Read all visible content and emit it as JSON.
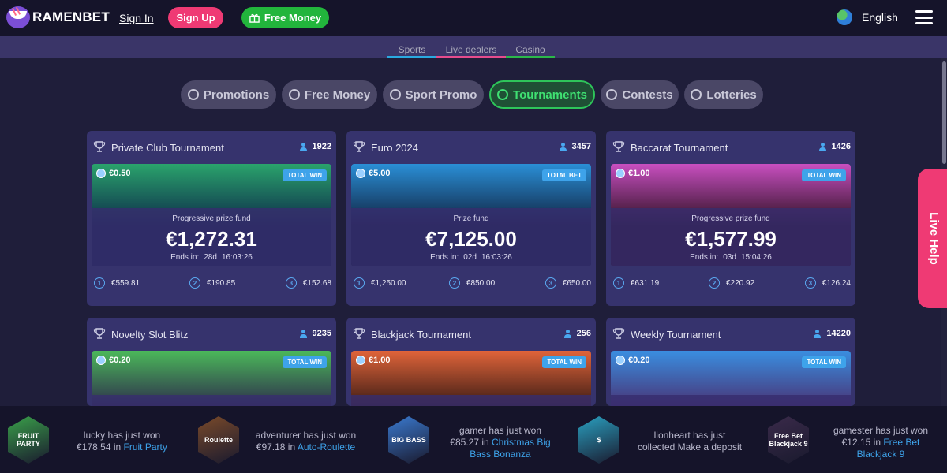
{
  "header": {
    "logo": "RAMENBET",
    "signin": "Sign In",
    "signup": "Sign Up",
    "free_money": "Free Money",
    "language": "English"
  },
  "subnav": [
    "Sports",
    "Live dealers",
    "Casino"
  ],
  "categories": [
    {
      "label": "Promotions",
      "active": false
    },
    {
      "label": "Free Money",
      "active": false
    },
    {
      "label": "Sport Promo",
      "active": false
    },
    {
      "label": "Tournaments",
      "active": true
    },
    {
      "label": "Contests",
      "active": false
    },
    {
      "label": "Lotteries",
      "active": false
    }
  ],
  "tournaments": [
    {
      "title": "Private Club Tournament",
      "players": "1922",
      "stake": "€0.50",
      "badge": "TOTAL WIN",
      "fund_label": "Progressive prize fund",
      "fund": "€1,272.31",
      "ends_label": "Ends in:",
      "ends_days": "28d",
      "ends_time": "16:03:26",
      "prizes": [
        "€559.81",
        "€190.85",
        "€152.68"
      ],
      "colors": [
        "#2aa36c",
        "#0d2a4a"
      ]
    },
    {
      "title": "Euro 2024",
      "players": "3457",
      "stake": "€5.00",
      "badge": "TOTAL BET",
      "fund_label": "Prize fund",
      "fund": "€7,125.00",
      "ends_label": "Ends in:",
      "ends_days": "02d",
      "ends_time": "16:03:26",
      "prizes": [
        "€1,250.00",
        "€850.00",
        "€650.00"
      ],
      "colors": [
        "#2a8fd6",
        "#10213e"
      ]
    },
    {
      "title": "Baccarat Tournament",
      "players": "1426",
      "stake": "€1.00",
      "badge": "TOTAL WIN",
      "fund_label": "Progressive prize fund",
      "fund": "€1,577.99",
      "ends_label": "Ends in:",
      "ends_days": "03d",
      "ends_time": "15:04:26",
      "prizes": [
        "€631.19",
        "€220.92",
        "€126.24"
      ],
      "colors": [
        "#c84fc0",
        "#2a1020"
      ]
    },
    {
      "title": "Novelty Slot Blitz",
      "players": "9235",
      "stake": "€0.20",
      "badge": "TOTAL WIN",
      "colors": [
        "#4bb85a",
        "#2a1f4a"
      ]
    },
    {
      "title": "Blackjack Tournament",
      "players": "256",
      "stake": "€1.00",
      "badge": "TOTAL WIN",
      "colors": [
        "#e0643a",
        "#2a1410"
      ]
    },
    {
      "title": "Weekly Tournament",
      "players": "14220",
      "stake": "€0.20",
      "badge": "TOTAL WIN",
      "colors": [
        "#3a8ee0",
        "#4a2a6a"
      ]
    }
  ],
  "live_help": "Live Help",
  "feed": [
    {
      "thumb": "FRUIT PARTY",
      "line1": "lucky has just won",
      "line2a": "€178.54 in ",
      "game": "Fruit Party",
      "color": "#3aa04a"
    },
    {
      "thumb": "Roulette",
      "line1": "adventurer has just won",
      "line2a": "€97.18 in ",
      "game": "Auto-Roulette",
      "color": "#7a4a2a"
    },
    {
      "thumb": "BIG BASS",
      "line1": "gamer has just won",
      "line2a": "€85.27 in ",
      "game": "Christmas Big Bass Bonanza",
      "color": "#3a7ad0"
    },
    {
      "thumb": "$",
      "line1": "lionheart has just",
      "line2a": "collected Make a deposit",
      "game": "",
      "color": "#2aa0c0"
    },
    {
      "thumb": "Free Bet Blackjack 9",
      "line1": "gamester has just won",
      "line2a": "€12.15 in ",
      "game": "Free Bet Blackjack 9",
      "color": "#3a2a4a"
    }
  ]
}
